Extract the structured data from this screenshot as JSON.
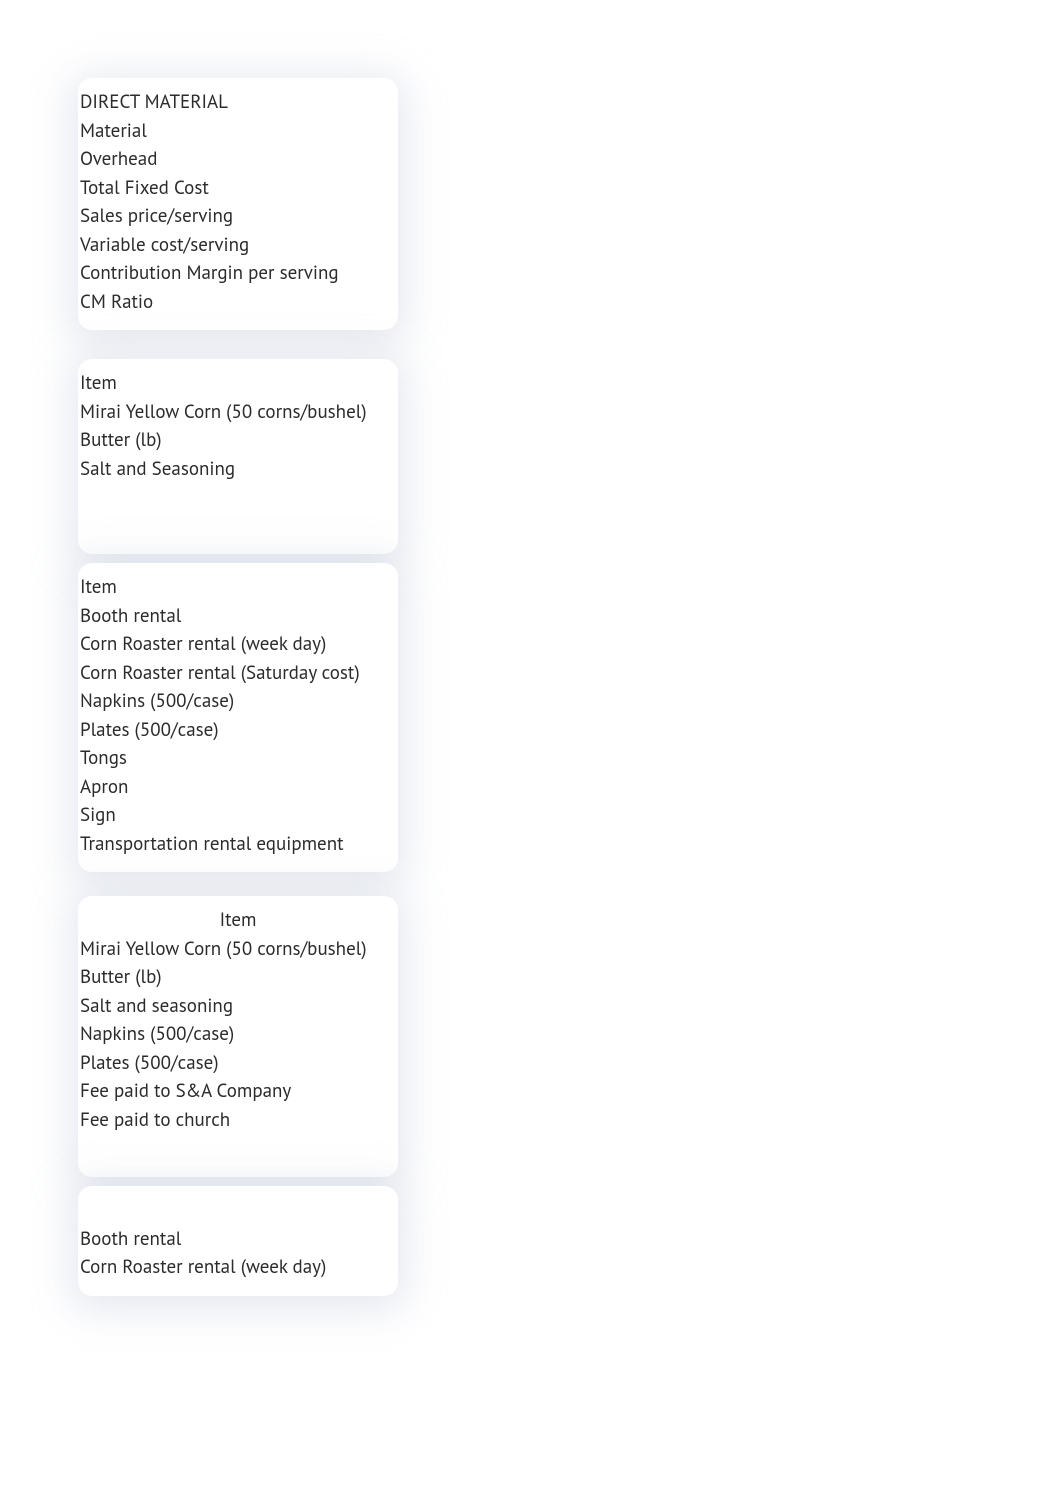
{
  "block1": {
    "rows": [
      "DIRECT MATERIAL",
      "Material",
      "Overhead",
      "Total Fixed Cost",
      "Sales price/serving",
      "Variable cost/serving",
      "Contribution Margin per serving",
      "CM Ratio"
    ]
  },
  "block2": {
    "rows": [
      "Item",
      "Mirai Yellow Corn (50 corns/bushel)",
      "Butter (lb)",
      "Salt and Seasoning"
    ]
  },
  "block3": {
    "rows": [
      "Item",
      "Booth rental",
      "Corn Roaster rental (week day)",
      "Corn Roaster rental (Saturday cost)",
      "Napkins (500/case)",
      "Plates (500/case)",
      "Tongs",
      "Apron",
      "Sign",
      "Transportation rental equipment"
    ]
  },
  "block4": {
    "header": "Item",
    "rows": [
      "Mirai Yellow Corn (50 corns/bushel)",
      "Butter (lb)",
      "Salt and seasoning",
      "Napkins (500/case)",
      "Plates (500/case)",
      "Fee paid to S&A Company",
      "Fee paid to church"
    ]
  },
  "block5": {
    "rows": [
      "Booth rental",
      "Corn Roaster rental (week day)"
    ]
  }
}
